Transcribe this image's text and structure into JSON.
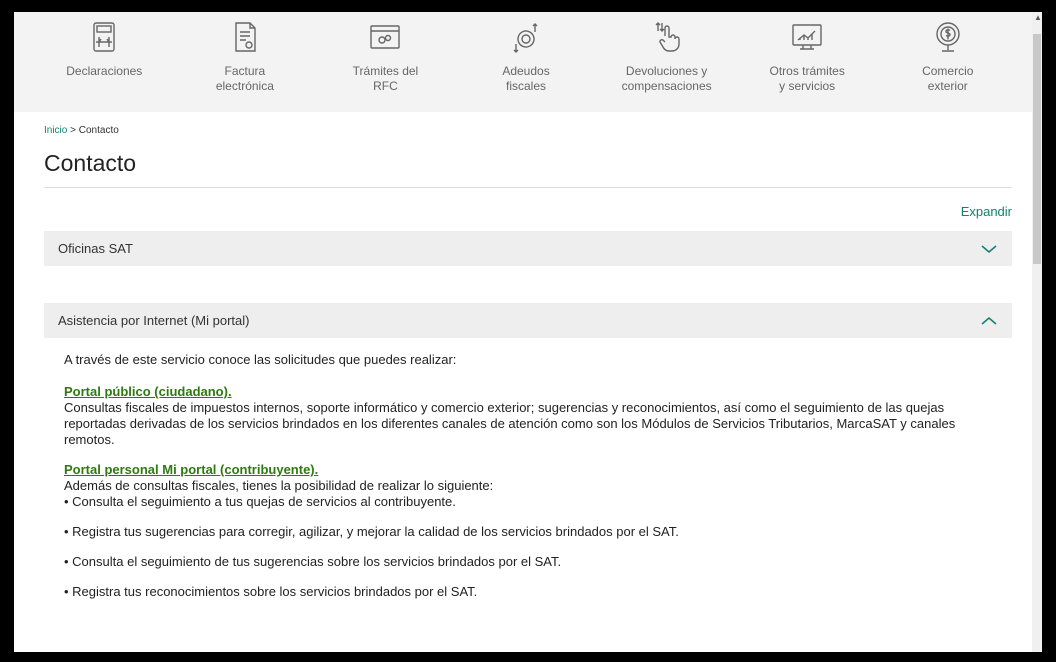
{
  "nav": {
    "items": [
      {
        "label": "Declaraciones",
        "icon": "calculator-icon"
      },
      {
        "label": "Factura\nelectrónica",
        "icon": "invoice-icon"
      },
      {
        "label": "Trámites del\nRFC",
        "icon": "rfc-card-icon"
      },
      {
        "label": "Adeudos\nfiscales",
        "icon": "debt-coins-icon"
      },
      {
        "label": "Devoluciones y\ncompensaciones",
        "icon": "refund-hand-icon"
      },
      {
        "label": "Otros trámites\ny servicios",
        "icon": "monitor-chart-icon"
      },
      {
        "label": "Comercio\nexterior",
        "icon": "globe-dollar-icon"
      }
    ]
  },
  "breadcrumb": {
    "home": "Inicio",
    "separator": " > ",
    "current": "Contacto"
  },
  "page_title": "Contacto",
  "expand_label": "Expandir",
  "accordion": [
    {
      "title": "Oficinas SAT",
      "state": "collapsed"
    },
    {
      "title": "Asistencia por Internet (Mi portal)",
      "state": "expanded"
    }
  ],
  "assist": {
    "intro": "A través de este servicio conoce las solicitudes que puedes realizar:",
    "public_link": "Portal público (ciudadano).",
    "public_text": "Consultas fiscales de impuestos internos, soporte informático y comercio exterior; sugerencias y reconocimientos, así como el seguimiento de las quejas reportadas derivadas de los servicios brindados en los diferentes canales de atención como son los Módulos de Servicios Tributarios, MarcaSAT y canales remotos.",
    "personal_link": "Portal personal Mi portal (contribuyente).",
    "personal_text": "Además de consultas fiscales, tienes la posibilidad de realizar lo siguiente:",
    "bullets": [
      "• Consulta el seguimiento a tus quejas de servicios al contribuyente.",
      "• Registra tus sugerencias para corregir, agilizar, y mejorar la calidad de los servicios brindados por el SAT.",
      "• Consulta el seguimiento de tus sugerencias sobre los servicios brindados por el SAT.",
      "• Registra tus reconocimientos sobre los servicios brindados por el SAT."
    ]
  },
  "colors": {
    "accent": "#10826f",
    "link": "#2d7a10",
    "header_bg": "#eeeeee",
    "nav_bg": "#f3f3f3"
  }
}
